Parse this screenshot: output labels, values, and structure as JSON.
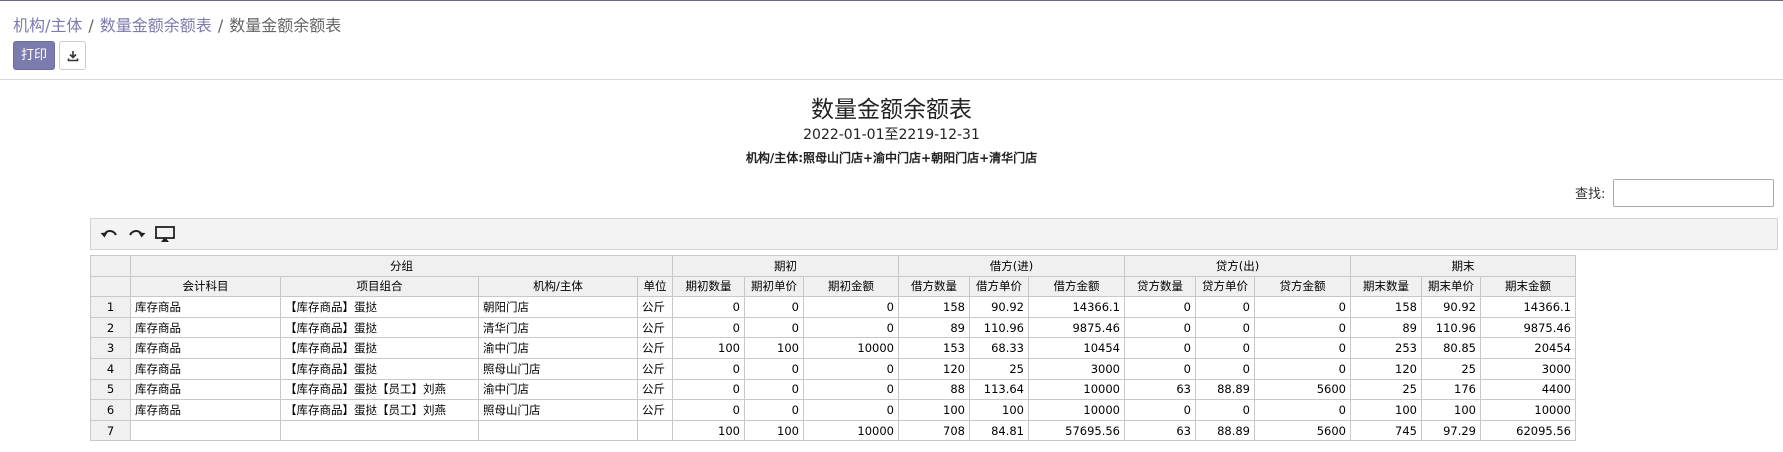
{
  "breadcrumb": {
    "item1": "机构/主体",
    "item2": "数量金额余额表",
    "current": "数量金额余额表",
    "sep": "/"
  },
  "actions": {
    "print_label": "打印",
    "download_icon": "download-icon"
  },
  "report": {
    "title": "数量金额余额表",
    "period": "2022-01-01至2219-12-31",
    "entity": "机构/主体:照母山门店+渝中门店+朝阳门店+清华门店"
  },
  "search": {
    "label": "查找:",
    "value": ""
  },
  "toolbar": {
    "icons": [
      "undo-icon",
      "redo-icon",
      "present-icon"
    ]
  },
  "grid": {
    "groups": [
      "分组",
      "期初",
      "借方(进)",
      "贷方(出)",
      "期末"
    ],
    "columns": [
      "会计科目",
      "项目组合",
      "机构/主体",
      "单位",
      "期初数量",
      "期初单价",
      "期初金额",
      "借方数量",
      "借方单价",
      "借方金额",
      "贷方数量",
      "贷方单价",
      "贷方金额",
      "期末数量",
      "期末单价",
      "期末金额"
    ],
    "rows": [
      [
        "1",
        "库存商品",
        "【库存商品】蛋挞",
        "朝阳门店",
        "公斤",
        "0",
        "0",
        "0",
        "158",
        "90.92",
        "14366.1",
        "0",
        "0",
        "0",
        "158",
        "90.92",
        "14366.1"
      ],
      [
        "2",
        "库存商品",
        "【库存商品】蛋挞",
        "清华门店",
        "公斤",
        "0",
        "0",
        "0",
        "89",
        "110.96",
        "9875.46",
        "0",
        "0",
        "0",
        "89",
        "110.96",
        "9875.46"
      ],
      [
        "3",
        "库存商品",
        "【库存商品】蛋挞",
        "渝中门店",
        "公斤",
        "100",
        "100",
        "10000",
        "153",
        "68.33",
        "10454",
        "0",
        "0",
        "0",
        "253",
        "80.85",
        "20454"
      ],
      [
        "4",
        "库存商品",
        "【库存商品】蛋挞",
        "照母山门店",
        "公斤",
        "0",
        "0",
        "0",
        "120",
        "25",
        "3000",
        "0",
        "0",
        "0",
        "120",
        "25",
        "3000"
      ],
      [
        "5",
        "库存商品",
        "【库存商品】蛋挞【员工】刘燕",
        "渝中门店",
        "公斤",
        "0",
        "0",
        "0",
        "88",
        "113.64",
        "10000",
        "63",
        "88.89",
        "5600",
        "25",
        "176",
        "4400"
      ],
      [
        "6",
        "库存商品",
        "【库存商品】蛋挞【员工】刘燕",
        "照母山门店",
        "公斤",
        "0",
        "0",
        "0",
        "100",
        "100",
        "10000",
        "0",
        "0",
        "0",
        "100",
        "100",
        "10000"
      ],
      [
        "7",
        "",
        "",
        "",
        "",
        "100",
        "100",
        "10000",
        "708",
        "84.81",
        "57695.56",
        "63",
        "88.89",
        "5600",
        "745",
        "97.29",
        "62095.56"
      ]
    ]
  }
}
